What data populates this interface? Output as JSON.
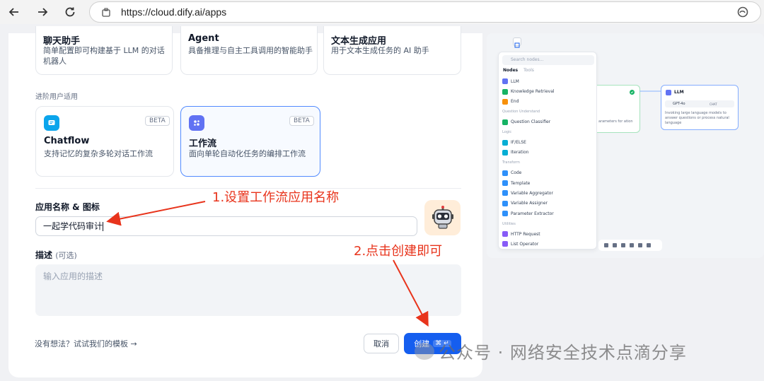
{
  "browser": {
    "url": "https://cloud.dify.ai/apps"
  },
  "modal": {
    "top_cards": [
      {
        "title": "聊天助手",
        "desc": "简单配置即可构建基于 LLM 的对话机器人"
      },
      {
        "title": "Agent",
        "desc": "具备推理与自主工具调用的智能助手"
      },
      {
        "title": "文本生成应用",
        "desc": "用于文本生成任务的 AI 助手"
      }
    ],
    "advanced_label": "进阶用户适用",
    "advanced_cards": [
      {
        "title": "Chatflow",
        "desc": "支持记忆的复杂多轮对话工作流",
        "badge": "BETA"
      },
      {
        "title": "工作流",
        "desc": "面向单轮自动化任务的编排工作流",
        "badge": "BETA"
      }
    ],
    "name_label": "应用名称 & 图标",
    "name_value": "一起学代码审计",
    "desc_label": "描述",
    "desc_optional": "(可选)",
    "desc_placeholder": "输入应用的描述",
    "template_link": "没有想法？试试我们的模板 →",
    "cancel": "取消",
    "create": "创建",
    "create_shortcut": "⌘ ↵"
  },
  "annotations": {
    "step1": "1.设置工作流应用名称",
    "step2": "2.点击创建即可"
  },
  "watermark": "公众号 · 网络安全技术点滴分享",
  "preview": {
    "search_placeholder": "Search nodes...",
    "tabs": [
      "Nodes",
      "Tools"
    ],
    "items": [
      {
        "kind": "node",
        "label": "LLM",
        "color": "#6172f3"
      },
      {
        "kind": "node",
        "label": "Knowledge Retrieval",
        "color": "#16b364"
      },
      {
        "kind": "node",
        "label": "End",
        "color": "#f79009"
      },
      {
        "kind": "group",
        "label": "Question Understand"
      },
      {
        "kind": "node",
        "label": "Question Classifier",
        "color": "#16b364"
      },
      {
        "kind": "group",
        "label": "Logic"
      },
      {
        "kind": "node",
        "label": "IF/ELSE",
        "color": "#06aed4"
      },
      {
        "kind": "node",
        "label": "Iteration",
        "color": "#06aed4"
      },
      {
        "kind": "group",
        "label": "Transform"
      },
      {
        "kind": "node",
        "label": "Code",
        "color": "#2e90fa"
      },
      {
        "kind": "node",
        "label": "Template",
        "color": "#2e90fa"
      },
      {
        "kind": "node",
        "label": "Variable Aggregator",
        "color": "#2e90fa"
      },
      {
        "kind": "node",
        "label": "Variable Assigner",
        "color": "#2e90fa"
      },
      {
        "kind": "node",
        "label": "Parameter Extractor",
        "color": "#2e90fa"
      },
      {
        "kind": "group",
        "label": "Utilities"
      },
      {
        "kind": "node",
        "label": "HTTP Request",
        "color": "#875bf7"
      },
      {
        "kind": "node",
        "label": "List Operator",
        "color": "#875bf7"
      }
    ],
    "llm_node": {
      "title": "LLM",
      "model": "GPT-4o",
      "mode": "CHAT",
      "desc": "Invoking large language models to answer questions or process natural language"
    },
    "left_node_desc": "arameters for ation",
    "colors": {
      "accent": "#155eef",
      "green": "#16b364"
    }
  }
}
